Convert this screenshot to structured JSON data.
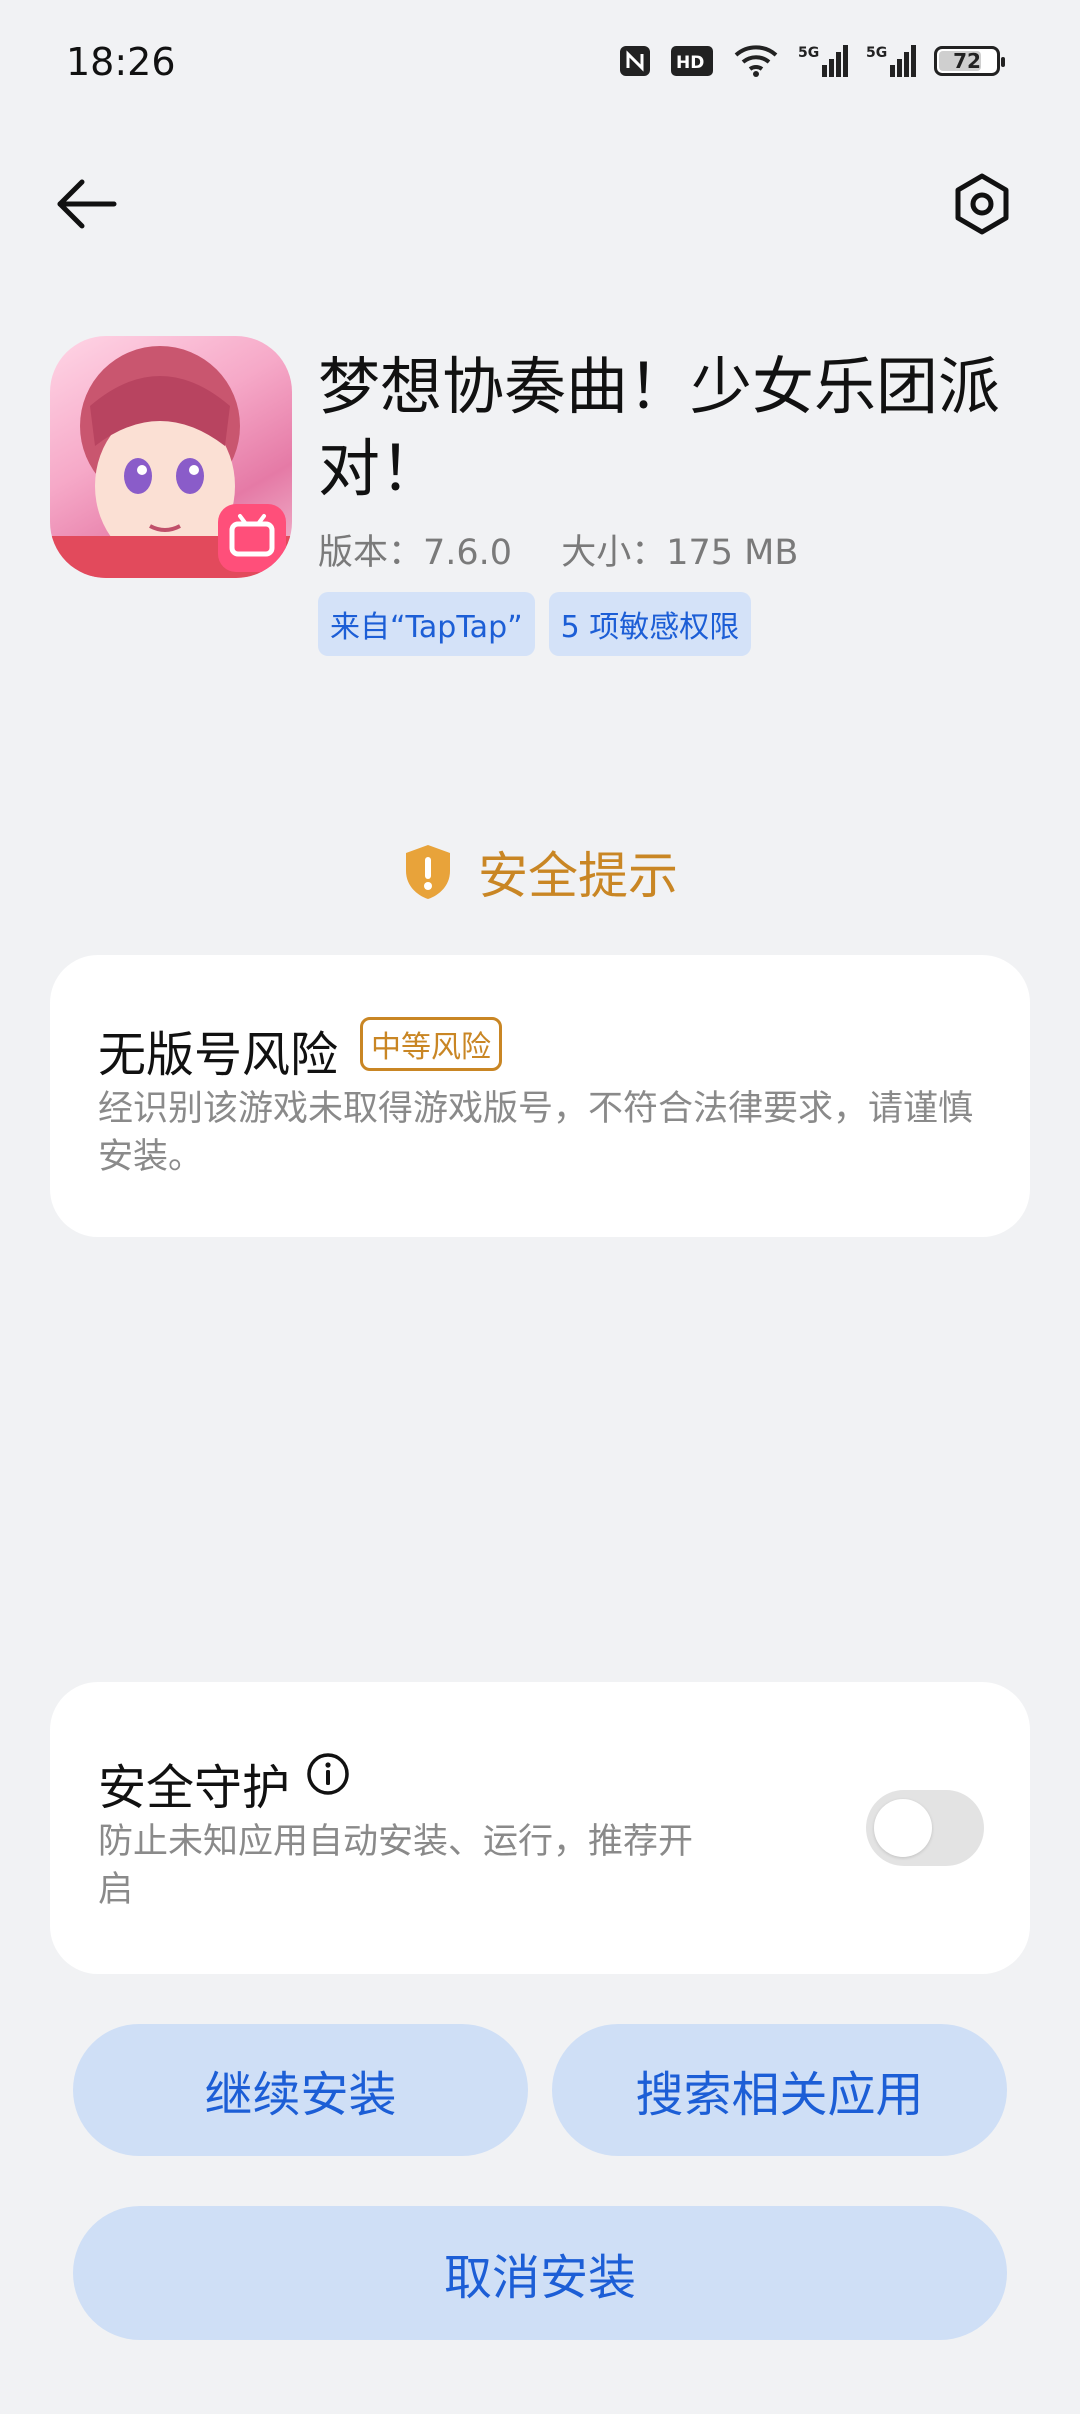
{
  "status_bar": {
    "time": "18:26",
    "battery": "72",
    "icons": [
      "nfc-icon",
      "hd-icon",
      "wifi-icon",
      "signal-5g-icon",
      "signal-5g-icon",
      "battery-icon"
    ]
  },
  "nav": {
    "back_icon": "arrow-left-icon",
    "settings_icon": "settings-icon"
  },
  "app": {
    "name": "梦想协奏曲！少女乐团派对！",
    "version": "版本：7.6.0",
    "size": "大小：175 MB",
    "source_chip": "来自“TapTap”",
    "permissions_chip": "5 项敏感权限"
  },
  "security_tip": {
    "title": "安全提示",
    "icon": "shield-alert-icon"
  },
  "risk": {
    "title": "无版号风险",
    "badge": "中等风险",
    "description": "经识别该游戏未取得游戏版号，不符合法律要求，请谨慎安装。"
  },
  "guard": {
    "title": "安全守护",
    "description": "防止未知应用自动安装、运行，推荐开启",
    "enabled": false
  },
  "buttons": {
    "continue": "继续安装",
    "search": "搜索相关应用",
    "cancel": "取消安装"
  },
  "colors": {
    "accent_blue": "#1c5ed6",
    "warning_orange": "#c98624",
    "button_bg": "#cfdff6",
    "page_bg": "#f1f2f4"
  }
}
